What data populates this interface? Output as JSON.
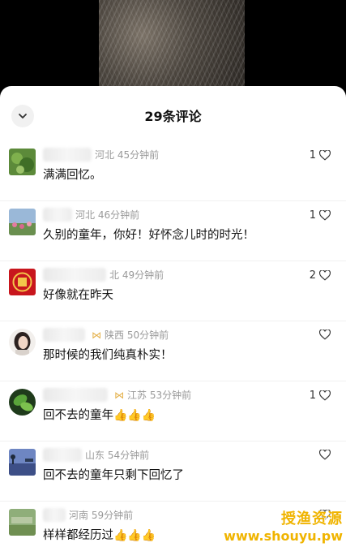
{
  "header": {
    "title": "29条评论"
  },
  "comments": [
    {
      "location": "河北",
      "time": "45分钟前",
      "text": "满满回忆。",
      "likes": "1",
      "blur_w": 60,
      "avatar": "plant"
    },
    {
      "location": "河北",
      "time": "46分钟前",
      "text": "久别的童年，你好！好怀念儿时的时光！",
      "likes": "1",
      "blur_w": 36,
      "avatar": "flowers"
    },
    {
      "location": "北",
      "time": "49分钟前",
      "text": "好像就在昨天",
      "likes": "2",
      "blur_w": 78,
      "avatar": "red-seal"
    },
    {
      "location": "陕西",
      "time": "50分钟前",
      "text": "那时候的我们纯真朴实！",
      "likes": "",
      "blur_w": 52,
      "avatar": "girl",
      "badge": true
    },
    {
      "location": "江苏",
      "time": "53分钟前",
      "text": "回不去的童年",
      "likes": "1",
      "blur_w": 80,
      "avatar": "leaf",
      "badge": true,
      "thumbs": 3
    },
    {
      "location": "山东",
      "time": "54分钟前",
      "text": "回不去的童年只剩下回忆了",
      "likes": "",
      "blur_w": 48,
      "avatar": "lake"
    },
    {
      "location": "河南",
      "time": "59分钟前",
      "text": "样样都经历过",
      "likes": "",
      "blur_w": 28,
      "avatar": "field",
      "thumbs": 3
    }
  ],
  "watermark": {
    "line1": "授渔资源",
    "line2": "www.shouyu.pw"
  },
  "icons": {
    "collapse": "chevron-down-icon",
    "like": "heart-outline-icon",
    "thumbs": "thumbs-up-emoji"
  }
}
